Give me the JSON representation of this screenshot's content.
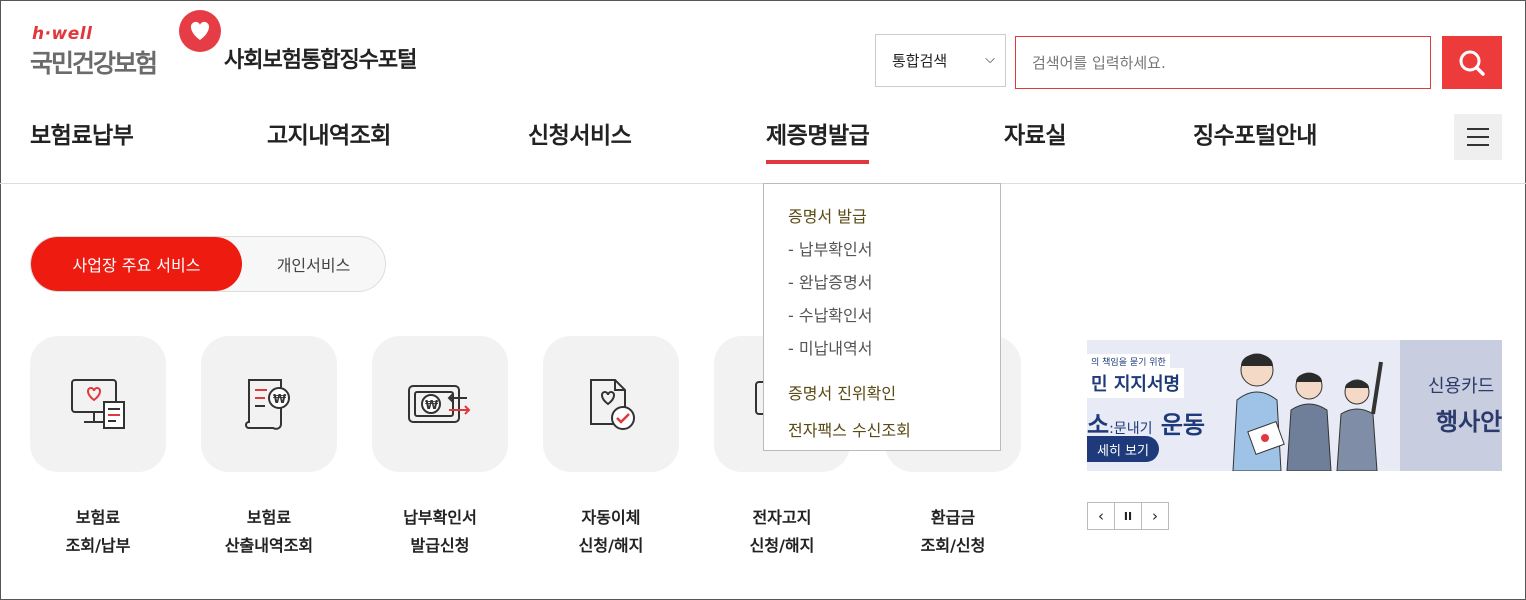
{
  "header": {
    "logo_small": "h·well",
    "logo_big": "국민건강보험",
    "portal_title": "사회보험통합징수포털"
  },
  "search": {
    "scope_value": "통합검색",
    "placeholder": "검색어를 입력하세요."
  },
  "gnb": {
    "items": [
      {
        "label": "보험료납부"
      },
      {
        "label": "고지내역조회"
      },
      {
        "label": "신청서비스"
      },
      {
        "label": "제증명발급"
      },
      {
        "label": "자료실"
      },
      {
        "label": "징수포털안내"
      }
    ],
    "active_index": 3
  },
  "dropdown": {
    "group1": "증명서 발급",
    "subs": [
      "- 납부확인서",
      "- 완납증명서",
      "- 수납확인서",
      "- 미납내역서"
    ],
    "item2": "증명서 진위확인",
    "item3": "전자팩스 수신조회"
  },
  "tabs": {
    "active": "사업장 주요 서비스",
    "inactive": "개인서비스"
  },
  "services": [
    {
      "line1": "보험료",
      "line2": "조회/납부",
      "icon": "monitor-receipt-icon"
    },
    {
      "line1": "보험료",
      "line2": "산출내역조회",
      "icon": "document-won-icon"
    },
    {
      "line1": "납부확인서",
      "line2": "발급신청",
      "icon": "bill-transfer-icon"
    },
    {
      "line1": "자동이체",
      "line2": "신청/해지",
      "icon": "document-check-icon"
    },
    {
      "line1": "전자고지",
      "line2": "신청/해지",
      "icon": "monitor-icon"
    },
    {
      "line1": "환급금",
      "line2": "조회/신청",
      "icon": "refund-icon"
    }
  ],
  "banner": {
    "small": "의 책임을 묻기 위한",
    "title": "민 지지서명",
    "left_big": "소",
    "left_small": ":문내기",
    "left_big2": "운동",
    "more": "세히 보기",
    "right_line1": "신용카드",
    "right_line2": "행사안"
  },
  "controls": {
    "prev": "‹",
    "pause": "II",
    "next": "›"
  },
  "colors": {
    "accent": "#e0383d",
    "tab_active": "#ee1b10",
    "search_button": "#ed3b3b"
  }
}
